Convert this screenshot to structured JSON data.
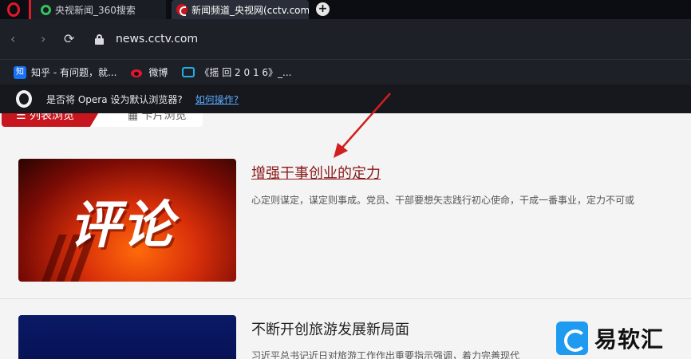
{
  "tabs": [
    {
      "title": "央视新闻_360搜索"
    },
    {
      "title": "新闻频道_央视网(cctv.com"
    }
  ],
  "new_tab_label": "+",
  "address_bar": {
    "url": "news.cctv.com"
  },
  "bookmarks": [
    {
      "label": "知乎 - 有问题，就...",
      "icon": "zhihu-icon",
      "icon_text": "知"
    },
    {
      "label": "微博",
      "icon": "weibo-icon"
    },
    {
      "label": "《摇 回 2 0 1 6》_...",
      "icon": "bilibili-icon"
    }
  ],
  "default_prompt": {
    "text": "是否将 Opera 设为默认浏览器?",
    "link": "如何操作?"
  },
  "view_tabs": {
    "list": "☰ 列表浏览",
    "card": "▦ 卡片浏览"
  },
  "articles": [
    {
      "thumb_text": "评论",
      "title": "增强干事创业的定力",
      "summary": "心定则谋定，谋定则事成。党员、干部要想矢志践行初心使命，干成一番事业，定力不可或"
    },
    {
      "title": "不断开创旅游发展新局面",
      "summary": "习近平总书记近日对旅游工作作出重要指示强调，着力完善现代"
    }
  ],
  "watermark": {
    "text": "易软汇"
  },
  "colors": {
    "brand_red": "#c8161e",
    "opera_red": "#e0192b",
    "link_blue": "#5aa9ff",
    "watermark_blue": "#1e9af0"
  }
}
